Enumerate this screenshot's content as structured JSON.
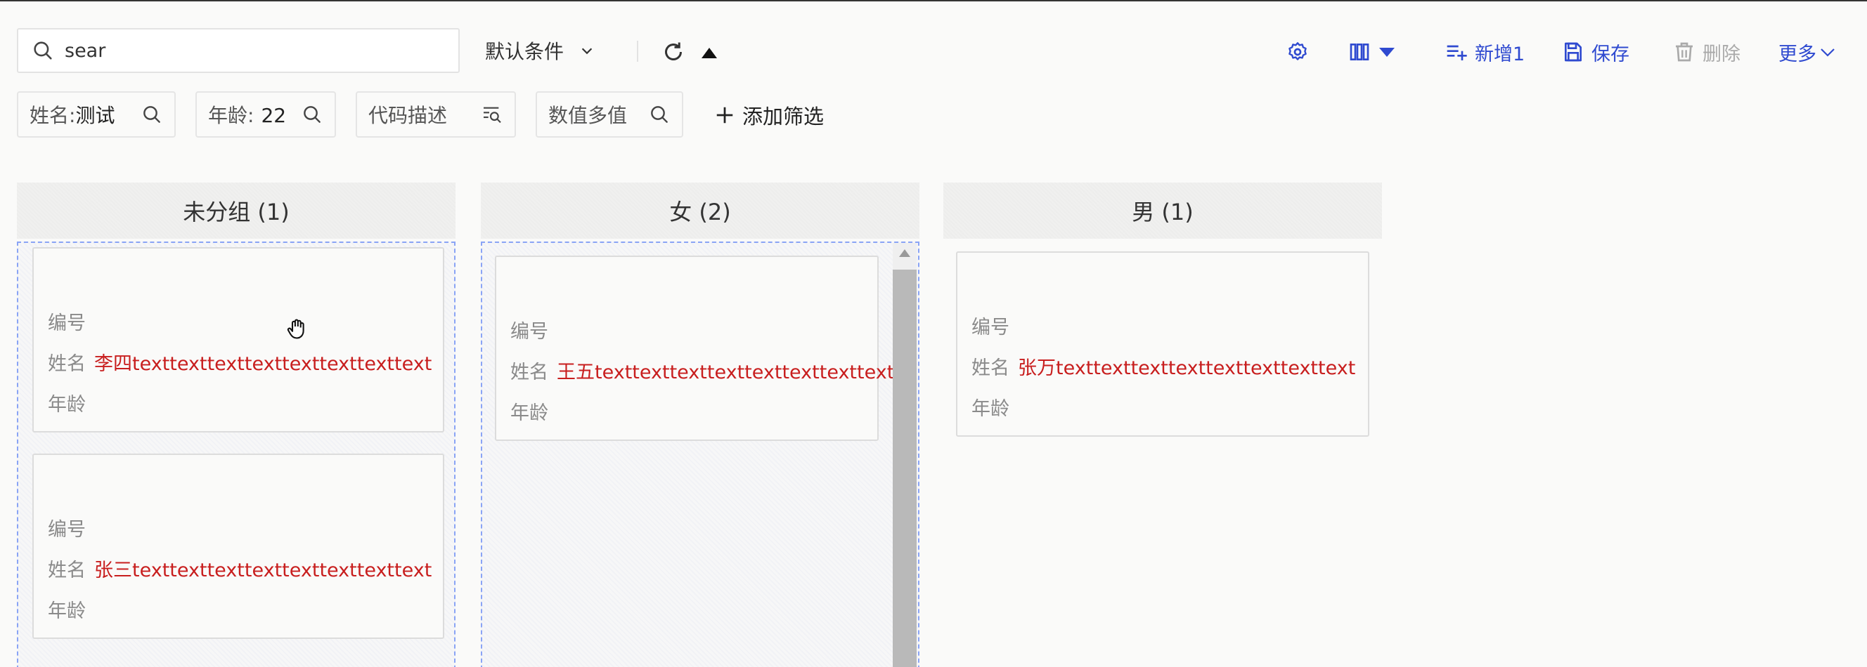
{
  "toolbar": {
    "search_value": "sear",
    "condition_label": "默认条件",
    "add_label": "新增1",
    "save_label": "保存",
    "delete_label": "删除",
    "more_label": "更多"
  },
  "filters": [
    {
      "label": "姓名:",
      "value": "测试"
    },
    {
      "label": "年龄:",
      "value": "22"
    },
    {
      "label": "代码描述",
      "value": ""
    },
    {
      "label": "数值多值",
      "value": ""
    }
  ],
  "add_filter_label": "添加筛选",
  "field_labels": {
    "code": "编号",
    "name": "姓名",
    "age": "年龄"
  },
  "columns": [
    {
      "title": "未分组 (1)",
      "cards": [
        {
          "name": "李四texttexttexttexttexttexttexttext"
        },
        {
          "name": "张三texttexttexttexttexttexttexttext"
        }
      ]
    },
    {
      "title": "女 (2)",
      "cards": [
        {
          "name": "王五texttexttexttexttexttexttexttext..."
        }
      ]
    },
    {
      "title": "男 (1)",
      "cards": [
        {
          "name": "张万texttexttexttexttexttexttexttext"
        }
      ]
    }
  ],
  "colors": {
    "accent": "#2f4ad0",
    "name_value": "#c81e1e",
    "dashed_border": "#8aa4f5"
  }
}
